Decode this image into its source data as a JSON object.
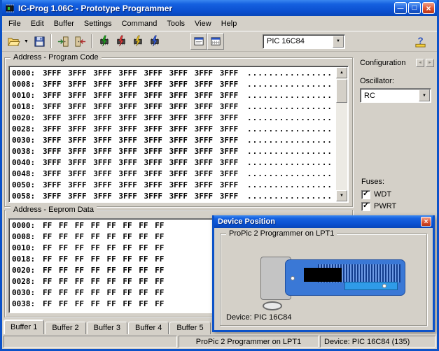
{
  "window": {
    "title": "IC-Prog 1.06C - Prototype Programmer",
    "minimize": "—",
    "maximize": "□",
    "close": "×"
  },
  "menu": {
    "items": [
      "File",
      "Edit",
      "Buffer",
      "Settings",
      "Command",
      "Tools",
      "View",
      "Help"
    ]
  },
  "toolbar": {
    "device_select": "PIC 16C84",
    "dropdown_glyph": "▼"
  },
  "scrollbar": {
    "up": "▲",
    "down": "▼"
  },
  "program_code": {
    "label": "Address - Program Code",
    "rows": [
      {
        "addr": "0000:",
        "values": "3FFF 3FFF 3FFF 3FFF 3FFF 3FFF 3FFF 3FFF",
        "ascii": "................"
      },
      {
        "addr": "0008:",
        "values": "3FFF 3FFF 3FFF 3FFF 3FFF 3FFF 3FFF 3FFF",
        "ascii": "................"
      },
      {
        "addr": "0010:",
        "values": "3FFF 3FFF 3FFF 3FFF 3FFF 3FFF 3FFF 3FFF",
        "ascii": "................"
      },
      {
        "addr": "0018:",
        "values": "3FFF 3FFF 3FFF 3FFF 3FFF 3FFF 3FFF 3FFF",
        "ascii": "................"
      },
      {
        "addr": "0020:",
        "values": "3FFF 3FFF 3FFF 3FFF 3FFF 3FFF 3FFF 3FFF",
        "ascii": "................"
      },
      {
        "addr": "0028:",
        "values": "3FFF 3FFF 3FFF 3FFF 3FFF 3FFF 3FFF 3FFF",
        "ascii": "................"
      },
      {
        "addr": "0030:",
        "values": "3FFF 3FFF 3FFF 3FFF 3FFF 3FFF 3FFF 3FFF",
        "ascii": "................"
      },
      {
        "addr": "0038:",
        "values": "3FFF 3FFF 3FFF 3FFF 3FFF 3FFF 3FFF 3FFF",
        "ascii": "................"
      },
      {
        "addr": "0040:",
        "values": "3FFF 3FFF 3FFF 3FFF 3FFF 3FFF 3FFF 3FFF",
        "ascii": "................"
      },
      {
        "addr": "0048:",
        "values": "3FFF 3FFF 3FFF 3FFF 3FFF 3FFF 3FFF 3FFF",
        "ascii": "................"
      },
      {
        "addr": "0050:",
        "values": "3FFF 3FFF 3FFF 3FFF 3FFF 3FFF 3FFF 3FFF",
        "ascii": "................"
      },
      {
        "addr": "0058:",
        "values": "3FFF 3FFF 3FFF 3FFF 3FFF 3FFF 3FFF 3FFF",
        "ascii": "................"
      }
    ]
  },
  "eeprom": {
    "label": "Address - Eeprom Data",
    "rows": [
      {
        "addr": "0000:",
        "values": "FF FF FF FF FF FF FF FF",
        "ascii": "........"
      },
      {
        "addr": "0008:",
        "values": "FF FF FF FF FF FF FF FF",
        "ascii": "........"
      },
      {
        "addr": "0010:",
        "values": "FF FF FF FF FF FF FF FF",
        "ascii": "........"
      },
      {
        "addr": "0018:",
        "values": "FF FF FF FF FF FF FF FF",
        "ascii": "........"
      },
      {
        "addr": "0020:",
        "values": "FF FF FF FF FF FF FF FF",
        "ascii": "........"
      },
      {
        "addr": "0028:",
        "values": "FF FF FF FF FF FF FF FF",
        "ascii": "........"
      },
      {
        "addr": "0030:",
        "values": "FF FF FF FF FF FF FF FF",
        "ascii": "........"
      },
      {
        "addr": "0038:",
        "values": "FF FF FF FF FF FF FF FF",
        "ascii": "........"
      }
    ]
  },
  "config": {
    "title": "Configuration",
    "left_arrow": "◄",
    "right_arrow": "►",
    "oscillator_label": "Oscillator:",
    "oscillator_value": "RC",
    "fuses_label": "Fuses:",
    "fuses": [
      {
        "label": "WDT",
        "mark": "✓",
        "checked": true
      },
      {
        "label": "PWRT",
        "mark": "✓",
        "checked": true
      }
    ]
  },
  "dialog": {
    "title": "Device Position",
    "close": "×",
    "group_label": "ProPic 2 Programmer on LPT1",
    "device_text": "Device: PIC 16C84"
  },
  "tabs": [
    {
      "label": "Buffer 1",
      "active": true
    },
    {
      "label": "Buffer 2"
    },
    {
      "label": "Buffer 3"
    },
    {
      "label": "Buffer 4"
    },
    {
      "label": "Buffer 5"
    }
  ],
  "status": {
    "left": "",
    "middle": "ProPic 2 Programmer on LPT1",
    "right": "Device: PIC 16C84 (135)"
  }
}
